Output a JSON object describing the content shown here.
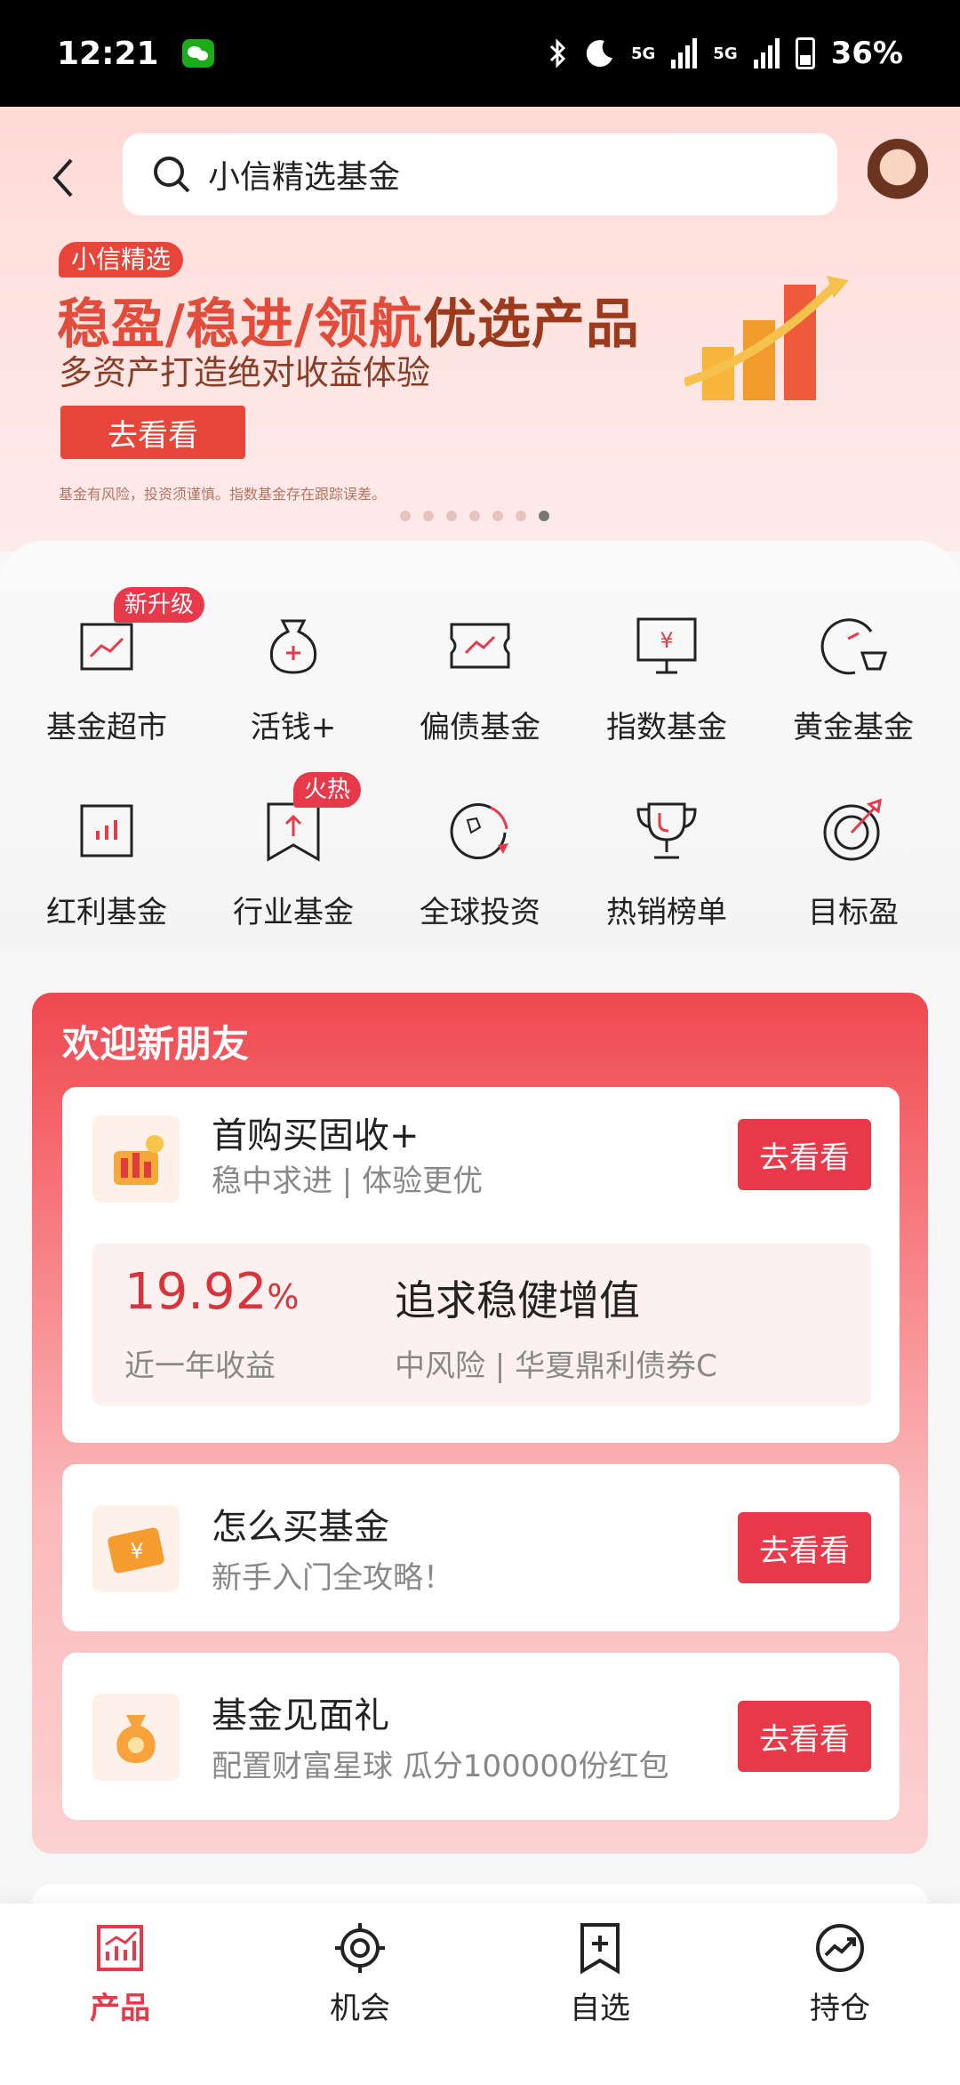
{
  "status_bar": {
    "time": "12:21",
    "battery": "36%",
    "net1": "5G",
    "net2": "5G"
  },
  "header": {
    "search_text": "小信精选基金"
  },
  "banner": {
    "tag": "小信精选",
    "title_part1": "稳盈/稳进/领航",
    "title_part2": "优选产品",
    "subtitle": "多资产打造绝对收益体验",
    "cta": "去看看",
    "disclaimer": "基金有风险，投资须谨慎。指数基金存在跟踪误差。"
  },
  "quick_menu": {
    "items": [
      {
        "label": "基金超市",
        "badge": "新升级",
        "icon": "chart-board-icon"
      },
      {
        "label": "活钱+",
        "icon": "money-bag-icon"
      },
      {
        "label": "偏债基金",
        "icon": "ticket-chart-icon"
      },
      {
        "label": "指数基金",
        "icon": "monitor-yen-icon"
      },
      {
        "label": "黄金基金",
        "icon": "gold-basket-icon"
      },
      {
        "label": "红利基金",
        "icon": "bar-chart-icon"
      },
      {
        "label": "行业基金",
        "badge": "火热",
        "icon": "bookmark-up-icon"
      },
      {
        "label": "全球投资",
        "icon": "globe-arrow-icon"
      },
      {
        "label": "热销榜单",
        "icon": "trophy-icon"
      },
      {
        "label": "目标盈",
        "icon": "target-icon"
      }
    ]
  },
  "welcome": {
    "title": "欢迎新朋友",
    "cards": [
      {
        "name": "首购买固收+",
        "desc": "稳中求进 | 体验更优",
        "button": "去看看",
        "rate": "19.92",
        "rate_unit": "%",
        "rate_label": "近一年收益",
        "pitch": "追求稳健增值",
        "fund": "中风险 | 华夏鼎利债券C"
      },
      {
        "name": "怎么买基金",
        "desc": "新手入门全攻略！",
        "button": "去看看"
      },
      {
        "name": "基金见面礼",
        "desc": "配置财富星球 瓜分100000份红包",
        "button": "去看看"
      }
    ]
  },
  "bottom_nav": {
    "items": [
      {
        "label": "产品",
        "active": true
      },
      {
        "label": "机会"
      },
      {
        "label": "自选"
      },
      {
        "label": "持仓"
      }
    ]
  },
  "colors": {
    "accent": "#e8394a",
    "banner_red": "#e24c3b"
  }
}
